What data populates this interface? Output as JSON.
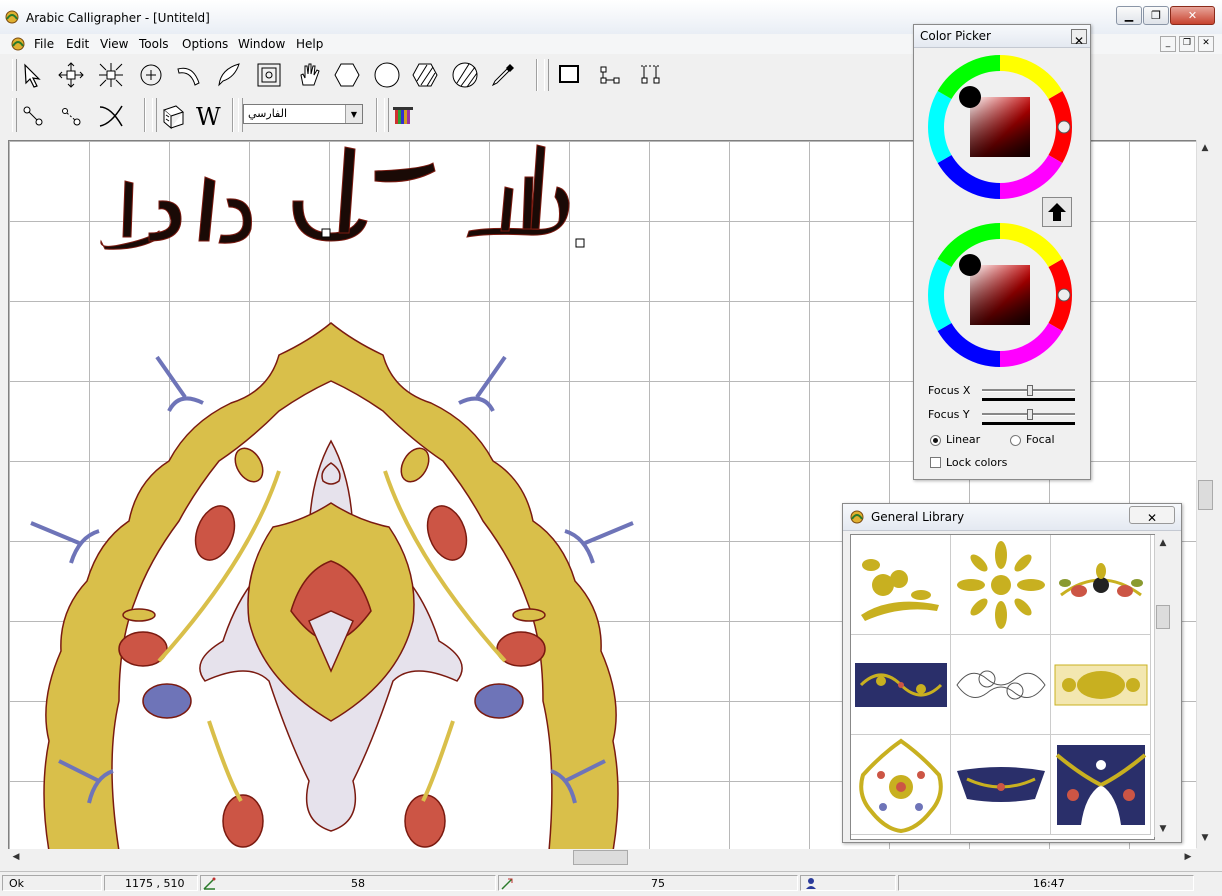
{
  "window": {
    "title": "Arabic Calligrapher - [Untiteld]"
  },
  "menu": [
    "File",
    "Edit",
    "View",
    "Tools",
    "Options",
    "Window",
    "Help"
  ],
  "toolbar": {
    "row1_icons": [
      "pointer-icon",
      "move-icon",
      "scale-icon",
      "rotate-icon",
      "curve-icon",
      "freeform-icon",
      "frame-icon",
      "hand-icon",
      "hexagon-icon",
      "circle-icon",
      "hatch-icon",
      "hatch-circle-icon",
      "eyedropper-icon"
    ],
    "row1_right_icons": [
      "rectangle-frame-icon",
      "align-bottom-icon",
      "distribute-icon"
    ],
    "row2_icons": [
      "node-edit-icon",
      "node-add-icon",
      "knife-icon",
      "library-icon",
      "word-icon"
    ],
    "language_combo": "الفارسي",
    "gradient_icon": "gradient-icon"
  },
  "canvas": {
    "calligraphy_text": "الله جل جلاله"
  },
  "color_picker": {
    "title": "Color Picker",
    "focus_x_label": "Focus X",
    "focus_y_label": "Focus Y",
    "linear_label": "Linear",
    "focal_label": "Focal",
    "selected_mode": "Linear",
    "lock_colors_label": "Lock colors",
    "lock_colors_checked": false
  },
  "library": {
    "title": "General Library",
    "items": [
      "floral-sprig",
      "golden-rosette",
      "flower-pair",
      "navy-border",
      "outline-scroll",
      "gold-cartouche",
      "medallion",
      "navy-arch",
      "corner-ornament"
    ]
  },
  "statusbar": {
    "status": "Ok",
    "coords": "1175 , 510",
    "value_a": "58",
    "value_b": "75",
    "time": "16:47"
  },
  "colors": {
    "gold": "#d9bf4a",
    "red": "#cc5545",
    "lavender": "#e6e2ec",
    "blue": "#6e74b8",
    "outline": "#7a1a10"
  }
}
